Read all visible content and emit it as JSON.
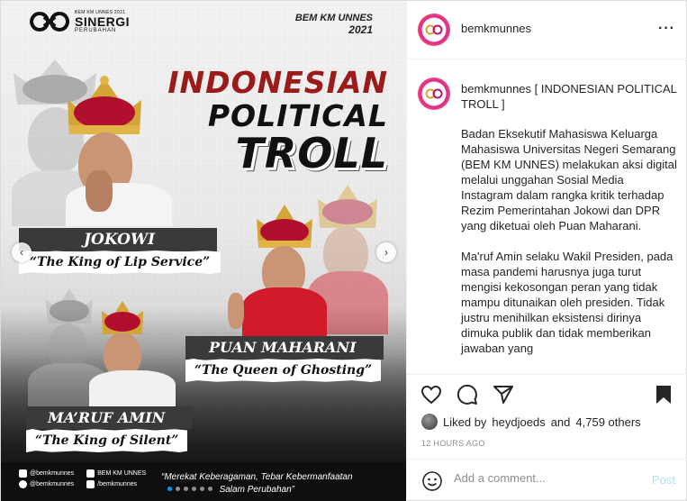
{
  "post_image": {
    "logo_small": "BEM KM UNNES 2021",
    "logo_big": "SINERGI",
    "logo_sub": "PERUBAHAN",
    "org_line1": "BEM KM UNNES",
    "org_line2": "2021",
    "headline_1": "INDONESIAN",
    "headline_2": "POLITICAL",
    "headline_3": "TROLL",
    "figures": [
      {
        "name": "JOKOWI",
        "quote": "“The King of Lip Service”"
      },
      {
        "name": "PUAN MAHARANI",
        "quote": "“The Queen of Ghosting”"
      },
      {
        "name": "MA’RUF AMIN",
        "quote": "“The King of Silent”"
      }
    ],
    "socials": [
      {
        "icon": "instagram-icon",
        "label": "@bemkmunnes"
      },
      {
        "icon": "youtube-icon",
        "label": "BEM KM UNNES"
      },
      {
        "icon": "twitter-icon",
        "label": "@bemkmunnes"
      },
      {
        "icon": "facebook-icon",
        "label": "/bemkmunnes"
      }
    ],
    "slogan_line1": "“Merekat Keberagaman, Tebar Kebermanfaatan",
    "slogan_line2": "Salam Perubahan”",
    "carousel_dots": 6,
    "active_dot": 0
  },
  "header": {
    "username": "bemkmunnes",
    "more_icon": "more-horizontal-icon"
  },
  "caption": {
    "username": "bemkmunnes",
    "title": "[ INDONESIAN POLITICAL TROLL ]",
    "paragraph_1": "Badan Eksekutif Mahasiswa Keluarga Mahasiswa Universitas Negeri Semarang (BEM KM UNNES) melakukan aksi digital melalui unggahan Sosial Media Instagram dalam rangka kritik terhadap Rezim Pemerintahan Jokowi dan DPR yang diketuai oleh Puan Maharani.",
    "paragraph_2": "Ma'ruf Amin selaku Wakil Presiden, pada masa pandemi harusnya juga turut mengisi kekosongan peran yang tidak mampu ditunaikan oleh presiden. Tidak justru menihilkan eksistensi dirinya dimuka publik dan tidak memberikan jawaban yang"
  },
  "actions": {
    "icons": [
      "heart-icon",
      "comment-icon",
      "share-icon",
      "bookmark-icon"
    ]
  },
  "likes": {
    "prefix": "Liked by",
    "user": "heydjoeds",
    "conj": "and",
    "others": "4,759 others"
  },
  "timestamp": "12 HOURS AGO",
  "comment": {
    "placeholder": "Add a comment...",
    "post_label": "Post",
    "post_color": "#b2dffc"
  },
  "colors": {
    "headline_red": "#9b1b1b",
    "instagram_blue": "#0095f6"
  }
}
